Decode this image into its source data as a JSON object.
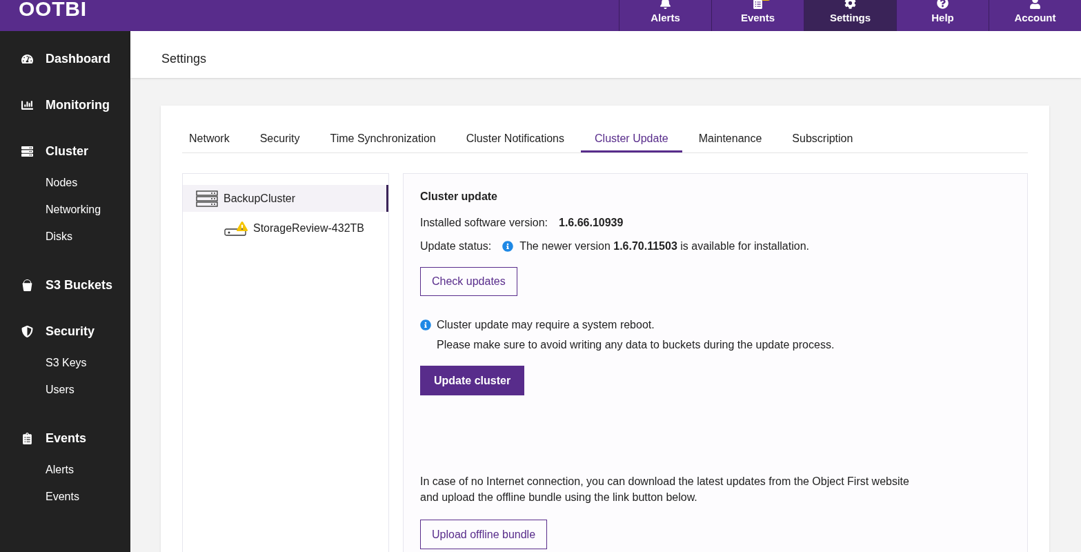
{
  "brand": "OOTBI",
  "top_nav": [
    {
      "label": "Alerts",
      "selected": false,
      "badge": false
    },
    {
      "label": "Events",
      "selected": false,
      "badge": true
    },
    {
      "label": "Settings",
      "selected": true,
      "badge": false
    },
    {
      "label": "Help",
      "selected": false,
      "badge": false
    },
    {
      "label": "Account",
      "selected": false,
      "badge": false
    }
  ],
  "sidebar": {
    "items": [
      {
        "label": "Dashboard"
      },
      {
        "label": "Monitoring"
      },
      {
        "label": "Cluster",
        "children": [
          {
            "label": "Nodes"
          },
          {
            "label": "Networking"
          },
          {
            "label": "Disks"
          }
        ]
      },
      {
        "label": "S3 Buckets"
      },
      {
        "label": "Security",
        "children": [
          {
            "label": "S3 Keys"
          },
          {
            "label": "Users"
          }
        ]
      },
      {
        "label": "Events",
        "children": [
          {
            "label": "Alerts"
          },
          {
            "label": "Events"
          }
        ]
      }
    ]
  },
  "page_title": "Settings",
  "tabs": [
    {
      "label": "Network",
      "selected": false
    },
    {
      "label": "Security",
      "selected": false
    },
    {
      "label": "Time Synchronization",
      "selected": false
    },
    {
      "label": "Cluster Notifications",
      "selected": false
    },
    {
      "label": "Cluster Update",
      "selected": true
    },
    {
      "label": "Maintenance",
      "selected": false
    },
    {
      "label": "Subscription",
      "selected": false
    }
  ],
  "tree": [
    {
      "label": "BackupCluster",
      "selected": true,
      "children": [
        {
          "label": "StorageReview-432TB",
          "selected": false,
          "warning": true
        }
      ]
    }
  ],
  "update": {
    "title": "Cluster update",
    "installed_label": "Installed software version:",
    "installed_value": "1.6.66.10939",
    "status_label": "Update status:",
    "status_text": "The newer version **1.6.70.11503** is available for installation.",
    "check_button": "Check updates",
    "notice_lines": [
      "Cluster update may require a system reboot.",
      "Please make sure to avoid writing any data to buckets during the update process."
    ],
    "update_button": "Update cluster",
    "offline_text": [
      "In case of no Internet connection, you can download the latest updates from the Object First website",
      "and upload the offline bundle using the link button below."
    ],
    "upload_button": "Upload offline bundle"
  }
}
